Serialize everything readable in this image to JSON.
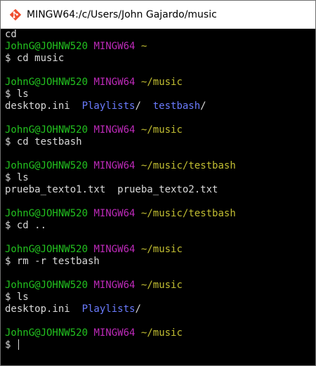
{
  "window": {
    "title": "MINGW64:/c/Users/John Gajardo/music",
    "icon": "git-bash-icon"
  },
  "colors": {
    "background": "#000000",
    "text": "#d8d8d8",
    "user": "#22c21f",
    "system": "#bd2ab9",
    "path": "#c2be32",
    "directory": "#6b7cff"
  },
  "terminal": {
    "lines": [
      [
        {
          "t": "cd",
          "c": "text"
        }
      ],
      [
        {
          "t": "JohnG@JOHNW520",
          "c": "user"
        },
        {
          "t": " ",
          "c": "text"
        },
        {
          "t": "MINGW64",
          "c": "sys"
        },
        {
          "t": " ",
          "c": "text"
        },
        {
          "t": "~",
          "c": "path"
        }
      ],
      [
        {
          "t": "$ cd music",
          "c": "text"
        }
      ],
      [
        {
          "t": "",
          "c": "text"
        }
      ],
      [
        {
          "t": "JohnG@JOHNW520",
          "c": "user"
        },
        {
          "t": " ",
          "c": "text"
        },
        {
          "t": "MINGW64",
          "c": "sys"
        },
        {
          "t": " ",
          "c": "text"
        },
        {
          "t": "~/music",
          "c": "path"
        }
      ],
      [
        {
          "t": "$ ls",
          "c": "text"
        }
      ],
      [
        {
          "t": "desktop.ini  ",
          "c": "text"
        },
        {
          "t": "Playlists",
          "c": "dir"
        },
        {
          "t": "/  ",
          "c": "text"
        },
        {
          "t": "testbash",
          "c": "dir"
        },
        {
          "t": "/",
          "c": "text"
        }
      ],
      [
        {
          "t": "",
          "c": "text"
        }
      ],
      [
        {
          "t": "JohnG@JOHNW520",
          "c": "user"
        },
        {
          "t": " ",
          "c": "text"
        },
        {
          "t": "MINGW64",
          "c": "sys"
        },
        {
          "t": " ",
          "c": "text"
        },
        {
          "t": "~/music",
          "c": "path"
        }
      ],
      [
        {
          "t": "$ cd testbash",
          "c": "text"
        }
      ],
      [
        {
          "t": "",
          "c": "text"
        }
      ],
      [
        {
          "t": "JohnG@JOHNW520",
          "c": "user"
        },
        {
          "t": " ",
          "c": "text"
        },
        {
          "t": "MINGW64",
          "c": "sys"
        },
        {
          "t": " ",
          "c": "text"
        },
        {
          "t": "~/music/testbash",
          "c": "path"
        }
      ],
      [
        {
          "t": "$ ls",
          "c": "text"
        }
      ],
      [
        {
          "t": "prueba_texto1.txt  prueba_texto2.txt",
          "c": "text"
        }
      ],
      [
        {
          "t": "",
          "c": "text"
        }
      ],
      [
        {
          "t": "JohnG@JOHNW520",
          "c": "user"
        },
        {
          "t": " ",
          "c": "text"
        },
        {
          "t": "MINGW64",
          "c": "sys"
        },
        {
          "t": " ",
          "c": "text"
        },
        {
          "t": "~/music/testbash",
          "c": "path"
        }
      ],
      [
        {
          "t": "$ cd ..",
          "c": "text"
        }
      ],
      [
        {
          "t": "",
          "c": "text"
        }
      ],
      [
        {
          "t": "JohnG@JOHNW520",
          "c": "user"
        },
        {
          "t": " ",
          "c": "text"
        },
        {
          "t": "MINGW64",
          "c": "sys"
        },
        {
          "t": " ",
          "c": "text"
        },
        {
          "t": "~/music",
          "c": "path"
        }
      ],
      [
        {
          "t": "$ rm -r testbash",
          "c": "text"
        }
      ],
      [
        {
          "t": "",
          "c": "text"
        }
      ],
      [
        {
          "t": "JohnG@JOHNW520",
          "c": "user"
        },
        {
          "t": " ",
          "c": "text"
        },
        {
          "t": "MINGW64",
          "c": "sys"
        },
        {
          "t": " ",
          "c": "text"
        },
        {
          "t": "~/music",
          "c": "path"
        }
      ],
      [
        {
          "t": "$ ls",
          "c": "text"
        }
      ],
      [
        {
          "t": "desktop.ini  ",
          "c": "text"
        },
        {
          "t": "Playlists",
          "c": "dir"
        },
        {
          "t": "/",
          "c": "text"
        }
      ],
      [
        {
          "t": "",
          "c": "text"
        }
      ],
      [
        {
          "t": "JohnG@JOHNW520",
          "c": "user"
        },
        {
          "t": " ",
          "c": "text"
        },
        {
          "t": "MINGW64",
          "c": "sys"
        },
        {
          "t": " ",
          "c": "text"
        },
        {
          "t": "~/music",
          "c": "path"
        }
      ],
      [
        {
          "t": "$ ",
          "c": "text"
        }
      ]
    ],
    "cursor_line": 26
  }
}
